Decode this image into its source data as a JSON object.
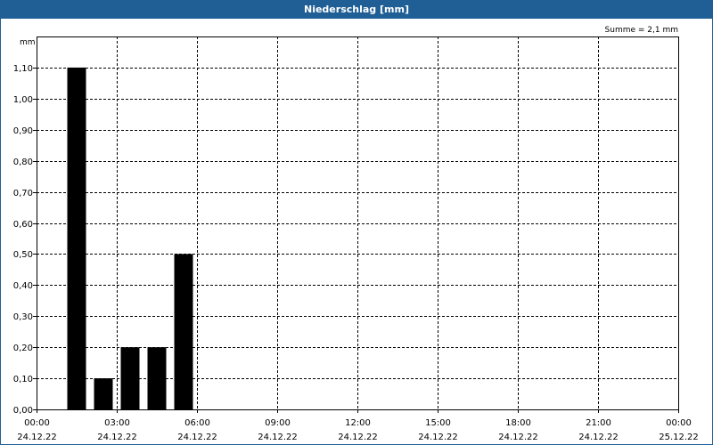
{
  "window": {
    "title": "Niederschlag [mm]"
  },
  "chart_data": {
    "type": "bar",
    "title": "Niederschlag [mm]",
    "ylabel": "mm",
    "annotation": "Summe = 2,1 mm",
    "ylim": [
      0,
      1.2
    ],
    "yticks": [
      {
        "value": 0.0,
        "label": "0,00"
      },
      {
        "value": 0.1,
        "label": "0,10"
      },
      {
        "value": 0.2,
        "label": "0,20"
      },
      {
        "value": 0.3,
        "label": "0,30"
      },
      {
        "value": 0.4,
        "label": "0,40"
      },
      {
        "value": 0.5,
        "label": "0,50"
      },
      {
        "value": 0.6,
        "label": "0,60"
      },
      {
        "value": 0.7,
        "label": "0,70"
      },
      {
        "value": 0.8,
        "label": "0,80"
      },
      {
        "value": 0.9,
        "label": "0,90"
      },
      {
        "value": 1.0,
        "label": "1,00"
      },
      {
        "value": 1.1,
        "label": "1,10"
      }
    ],
    "xlim_hours": [
      0,
      24
    ],
    "xticks": [
      {
        "hour": 0,
        "time": "00:00",
        "date": "24.12.22"
      },
      {
        "hour": 3,
        "time": "03:00",
        "date": "24.12.22"
      },
      {
        "hour": 6,
        "time": "06:00",
        "date": "24.12.22"
      },
      {
        "hour": 9,
        "time": "09:00",
        "date": "24.12.22"
      },
      {
        "hour": 12,
        "time": "12:00",
        "date": "24.12.22"
      },
      {
        "hour": 15,
        "time": "15:00",
        "date": "24.12.22"
      },
      {
        "hour": 18,
        "time": "18:00",
        "date": "24.12.22"
      },
      {
        "hour": 21,
        "time": "21:00",
        "date": "24.12.22"
      },
      {
        "hour": 24,
        "time": "00:00",
        "date": "25.12.22"
      }
    ],
    "bars": [
      {
        "hour": 2,
        "value": 1.1
      },
      {
        "hour": 3,
        "value": 0.1
      },
      {
        "hour": 4,
        "value": 0.2
      },
      {
        "hour": 5,
        "value": 0.2
      },
      {
        "hour": 6,
        "value": 0.5
      }
    ],
    "grid": true,
    "colors": {
      "bar": "#000000",
      "title_bg": "#1f5f95",
      "grid": "#000000"
    }
  }
}
